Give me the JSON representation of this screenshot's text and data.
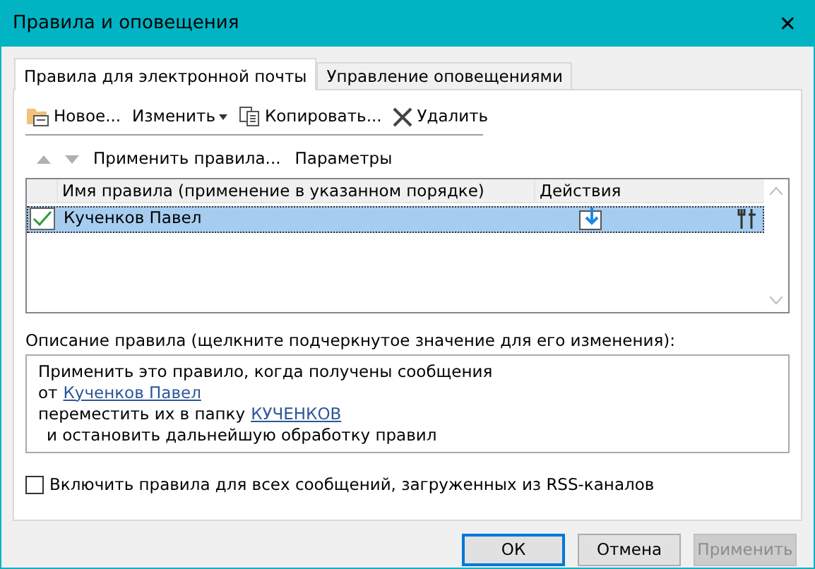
{
  "window": {
    "title": "Правила и оповещения",
    "close": "✕"
  },
  "tabs": [
    {
      "label": "Правила для электронной почты",
      "selected": true
    },
    {
      "label": "Управление оповещениями",
      "selected": false
    }
  ],
  "toolbar": [
    {
      "label": "Новое...",
      "kind": "new"
    },
    {
      "label": "Изменить",
      "kind": "dropdown"
    },
    {
      "label": "Копировать...",
      "kind": "copy"
    },
    {
      "label": "Удалить",
      "kind": "delete"
    }
  ],
  "toolbar2": {
    "move_up_disabled": true,
    "move_down_disabled": true,
    "actions": [
      "Применить правила...",
      "Параметры"
    ]
  },
  "rules_table": {
    "columns": [
      "Имя правила (применение в указанном порядке)",
      "Действия"
    ],
    "rows": [
      {
        "name": "Кученков Павел",
        "checked": true,
        "selected": true
      }
    ]
  },
  "description": {
    "label": "Описание правила (щелкните подчеркнутое значение для его изменения):",
    "lines": [
      {
        "text": "Применить это правило, когда получены сообщения",
        "indent": false
      },
      {
        "text": "от",
        "link": "Кученков Павел",
        "indent": false
      },
      {
        "text": "переместить их в папку",
        "link": "КУЧЕНКОВ",
        "indent": false
      },
      {
        "text": "и остановить дальнейшую обработку правил",
        "indent": true
      }
    ]
  },
  "rss_checkbox": {
    "label": "Включить правила для всех сообщений, загруженных из RSS-каналов",
    "checked": false
  },
  "buttons": [
    {
      "label": "ОК",
      "kind": "default",
      "disabled": false
    },
    {
      "label": "Отмена",
      "kind": "normal",
      "disabled": false
    },
    {
      "label": "Применить",
      "kind": "normal",
      "disabled": true
    }
  ]
}
